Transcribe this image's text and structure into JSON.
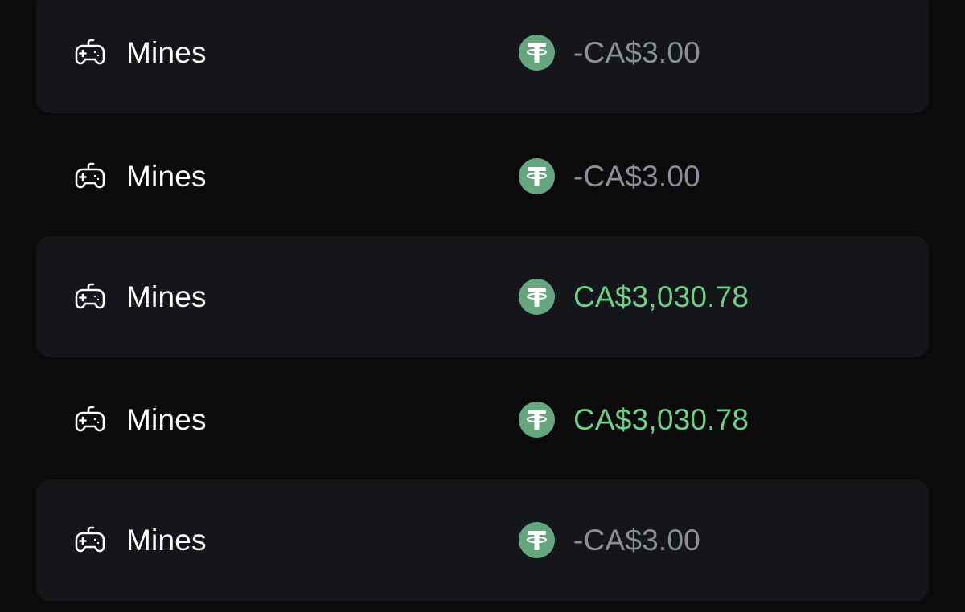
{
  "colors": {
    "background": "#0b0b0c",
    "row_shade": "#15161a",
    "text_primary": "#ffffff",
    "amount_loss": "#8c8f99",
    "amount_win": "#6fcf86",
    "coin": "#66a67f"
  },
  "icons": {
    "game": "gamepad-icon",
    "currency": "tether-coin-icon"
  },
  "bets": [
    {
      "game": "Mines",
      "amount": "-CA$3.00",
      "result": "loss"
    },
    {
      "game": "Mines",
      "amount": "-CA$3.00",
      "result": "loss"
    },
    {
      "game": "Mines",
      "amount": "CA$3,030.78",
      "result": "win"
    },
    {
      "game": "Mines",
      "amount": "CA$3,030.78",
      "result": "win"
    },
    {
      "game": "Mines",
      "amount": "-CA$3.00",
      "result": "loss"
    }
  ]
}
